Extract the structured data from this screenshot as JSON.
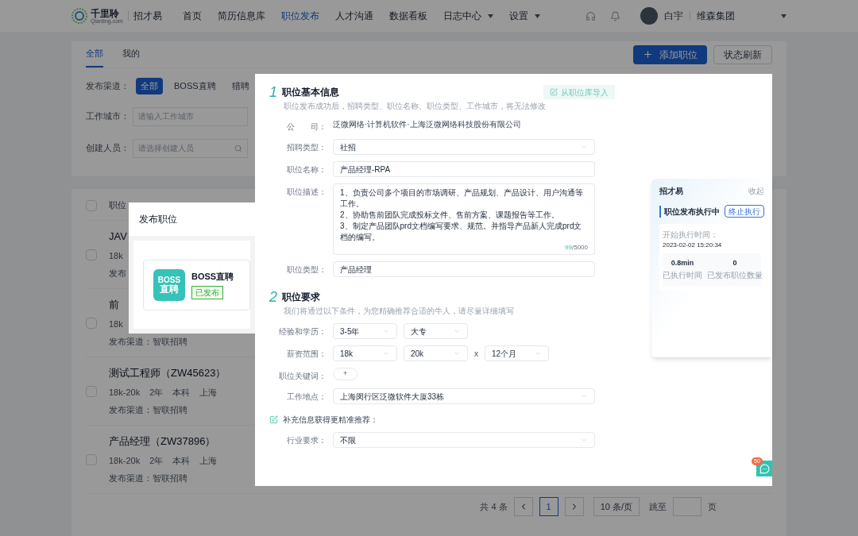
{
  "header": {
    "logo_name": "千里聆",
    "logo_sub": "Qianling.com",
    "product": "招才易",
    "nav": [
      {
        "label": "首页",
        "selected": false,
        "dropdown": false
      },
      {
        "label": "简历信息库",
        "selected": false,
        "dropdown": false
      },
      {
        "label": "职位发布",
        "selected": true,
        "dropdown": false
      },
      {
        "label": "人才沟通",
        "selected": false,
        "dropdown": false
      },
      {
        "label": "数据看板",
        "selected": false,
        "dropdown": false
      },
      {
        "label": "日志中心",
        "selected": false,
        "dropdown": true
      },
      {
        "label": "设置",
        "selected": false,
        "dropdown": true
      }
    ],
    "user": "白宇",
    "org": "维森集团"
  },
  "page": {
    "tabs": [
      {
        "label": "全部",
        "selected": true
      },
      {
        "label": "我的",
        "selected": false
      }
    ],
    "add_button": "添加职位",
    "refresh_button": "状态刷新",
    "filters": {
      "channel_label": "发布渠道：",
      "channels": [
        {
          "label": "全部",
          "selected": true
        },
        {
          "label": "BOSS直聘",
          "selected": false
        },
        {
          "label": "猎聘",
          "selected": false
        }
      ],
      "city_label": "工作城市：",
      "city_placeholder": "请输入工作城市",
      "creator_label": "创建人员：",
      "creator_placeholder": "请选择创建人员"
    },
    "list": {
      "header": "职位",
      "header_checked": false,
      "rows": [
        {
          "title": "JAV",
          "meta": [
            "18k"
          ],
          "channel": "发布",
          "checked": false
        },
        {
          "title": "前",
          "meta": [
            "18k"
          ],
          "channel": "发布渠道：智联招聘",
          "checked": false
        },
        {
          "title": "测试工程师（ZW45623）",
          "meta": [
            "18k-20k",
            "2年",
            "本科",
            "上海"
          ],
          "channel": "发布渠道：智联招聘",
          "checked": false
        },
        {
          "title": "产品经理（ZW37896）",
          "meta": [
            "18k-20k",
            "2年",
            "本科",
            "上海"
          ],
          "channel": "发布渠道：智联招聘",
          "checked": false
        }
      ]
    },
    "pagination": {
      "total": "共 4 条",
      "pages": [
        {
          "label": "1",
          "selected": true
        }
      ],
      "page_size": "10 条/页",
      "jump_label": "跳至",
      "page_suffix": "页"
    }
  },
  "publish_dialog": {
    "title": "发布职位",
    "channels": [
      {
        "logo_top": "BOSS",
        "logo_bottom": "直聘",
        "name": "BOSS直聘",
        "status": "已发布"
      }
    ]
  },
  "form": {
    "sections": [
      {
        "number": "1",
        "title": "职位基本信息",
        "hint": "职位发布成功后，招聘类型、职位名称、职位类型、工作城市，将无法修改",
        "import_button": "从职位库导入",
        "fields": [
          {
            "kind": "text",
            "label": "公　　司：",
            "value": "泛微网络·计算机软件·上海泛微网络科技股份有限公司"
          },
          {
            "kind": "select",
            "label": "招聘类型：",
            "value": "社招"
          },
          {
            "kind": "input",
            "label": "职位名称：",
            "value": "产品经理-RPA"
          },
          {
            "kind": "textarea",
            "label": "职位描述：",
            "value": "1、负责公司多个项目的市场调研、产品规划、产品设计、用户沟通等工作。\n2、协助售前团队完成投标文件、售前方案、课题报告等工作。\n3、制定产品团队prd文档编写要求、规范。并指导产品新人完成prd文档的编写。",
            "count": "99",
            "max": "/5000"
          },
          {
            "kind": "input",
            "label": "职位类型：",
            "value": "产品经理"
          }
        ]
      },
      {
        "number": "2",
        "title": "职位要求",
        "hint": "我们将通过以下条件，为您精确推荐合适的牛人，请尽量详细填写",
        "fields": [
          {
            "kind": "group",
            "label": "经验和学历：",
            "parts": [
              {
                "kind": "select",
                "value": "3-5年"
              },
              {
                "kind": "select",
                "value": "大专"
              }
            ]
          },
          {
            "kind": "group",
            "label": "薪资范围：",
            "parts": [
              {
                "kind": "select",
                "value": "18k"
              },
              {
                "kind": "select",
                "value": "20k"
              },
              {
                "kind": "sep",
                "value": "x"
              },
              {
                "kind": "select",
                "value": "12个月"
              }
            ]
          },
          {
            "kind": "tags",
            "label": "职位关键词：",
            "add": "+"
          },
          {
            "kind": "select",
            "label": "工作地点：",
            "value": "上海闵行区泛微软件大厦33栋"
          }
        ]
      }
    ],
    "extra": {
      "title": "补充信息获得更精准推荐：",
      "fields": [
        {
          "kind": "select",
          "label": "行业要求：",
          "value": "不限"
        }
      ]
    }
  },
  "task_panel": {
    "brand": "招才易",
    "collapse": "收起",
    "status": "职位发布执行中",
    "stop_button": "终止执行",
    "start_label": "开始执行时间：",
    "start_time": "2023-02-02 15:20:34",
    "stats": [
      {
        "value": "0.8min",
        "label": "已执行时间"
      },
      {
        "value": "0",
        "label": "已发布职位数量"
      }
    ]
  },
  "chat": {
    "badge": "50"
  }
}
